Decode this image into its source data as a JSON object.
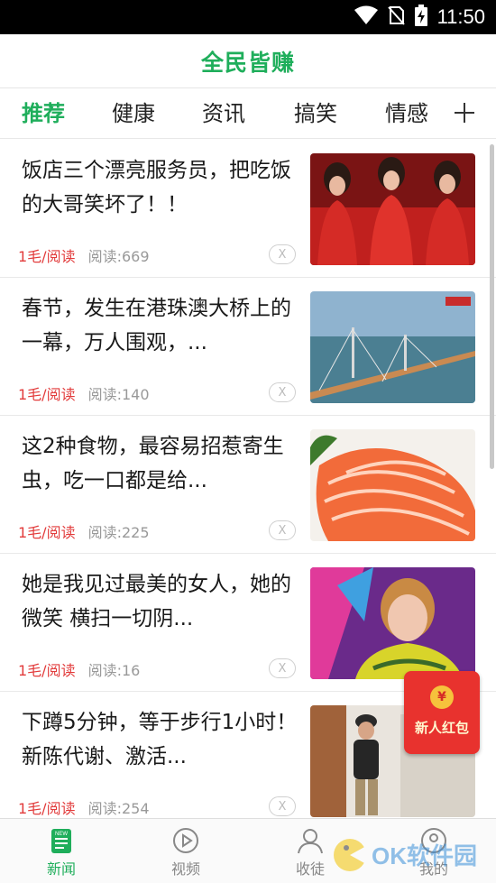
{
  "status_bar": {
    "time": "11:50"
  },
  "header": {
    "title": "全民皆赚"
  },
  "tabs": [
    {
      "label": "推荐",
      "active": true
    },
    {
      "label": "健康",
      "active": false
    },
    {
      "label": "资讯",
      "active": false
    },
    {
      "label": "搞笑",
      "active": false
    },
    {
      "label": "情感",
      "active": false
    }
  ],
  "tab_add_icon": "plus-icon",
  "feed": [
    {
      "title": "饭店三个漂亮服务员，把吃饭的大哥笑坏了！！",
      "reward": "1毛/阅读",
      "reads": "阅读:669",
      "close": "X"
    },
    {
      "title": "春节，发生在港珠澳大桥上的一幕，万人围观，...",
      "reward": "1毛/阅读",
      "reads": "阅读:140",
      "close": "X"
    },
    {
      "title": "这2种食物，最容易招惹寄生虫，吃一口都是给...",
      "reward": "1毛/阅读",
      "reads": "阅读:225",
      "close": "X"
    },
    {
      "title": "她是我见过最美的女人，她的微笑 横扫一切阴...",
      "reward": "1毛/阅读",
      "reads": "阅读:16",
      "close": "X"
    },
    {
      "title": "下蹲5分钟，等于步行1小时！新陈代谢、激活...",
      "reward": "1毛/阅读",
      "reads": "阅读:254",
      "close": "X"
    }
  ],
  "red_packet": {
    "coin": "¥",
    "label": "新人红包"
  },
  "bottom_nav": [
    {
      "label": "新闻",
      "icon": "news-icon",
      "active": true,
      "badge": "NEW"
    },
    {
      "label": "视频",
      "icon": "video-play-icon",
      "active": false
    },
    {
      "label": "收徒",
      "icon": "user-icon",
      "active": false
    },
    {
      "label": "我的",
      "icon": "profile-icon",
      "active": false
    }
  ],
  "watermark": {
    "text": "OK软件园"
  },
  "colors": {
    "brand_green": "#1fae5b",
    "reward_red": "#e23b3b",
    "red_packet": "#e8322e"
  }
}
